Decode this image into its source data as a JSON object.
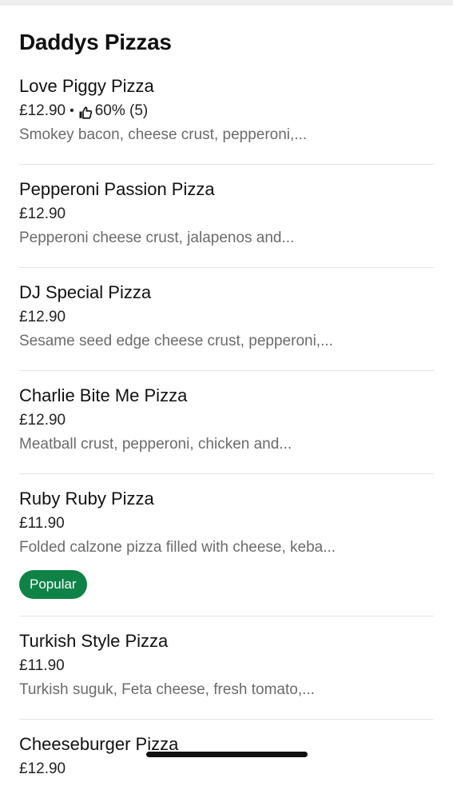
{
  "store": {
    "title": "Daddys Pizzas"
  },
  "items": [
    {
      "name": "Love Piggy Pizza",
      "price": "£12.90",
      "rating_separator": "•",
      "rating": "60% (5)",
      "description": "Smokey bacon, cheese crust, pepperoni,..."
    },
    {
      "name": "Pepperoni Passion Pizza",
      "price": "£12.90",
      "description": "Pepperoni cheese crust, jalapenos and..."
    },
    {
      "name": "DJ Special Pizza",
      "price": "£12.90",
      "description": "Sesame seed edge cheese crust, pepperoni,..."
    },
    {
      "name": "Charlie Bite Me Pizza",
      "price": "£12.90",
      "description": "Meatball crust, pepperoni, chicken and..."
    },
    {
      "name": "Ruby Ruby Pizza",
      "price": "£11.90",
      "description": "Folded calzone pizza filled with cheese, keba...",
      "badge": "Popular"
    },
    {
      "name": "Turkish Style Pizza",
      "price": "£11.90",
      "description": "Turkish suguk, Feta cheese, fresh tomato,..."
    },
    {
      "name": "Cheeseburger Pizza",
      "price": "£12.90"
    }
  ],
  "icons": {
    "thumbs_up": "thumbs-up-icon"
  },
  "colors": {
    "badge_background": "#0e8345",
    "description_text": "#6b6b6b",
    "divider": "#e6e6e6"
  }
}
